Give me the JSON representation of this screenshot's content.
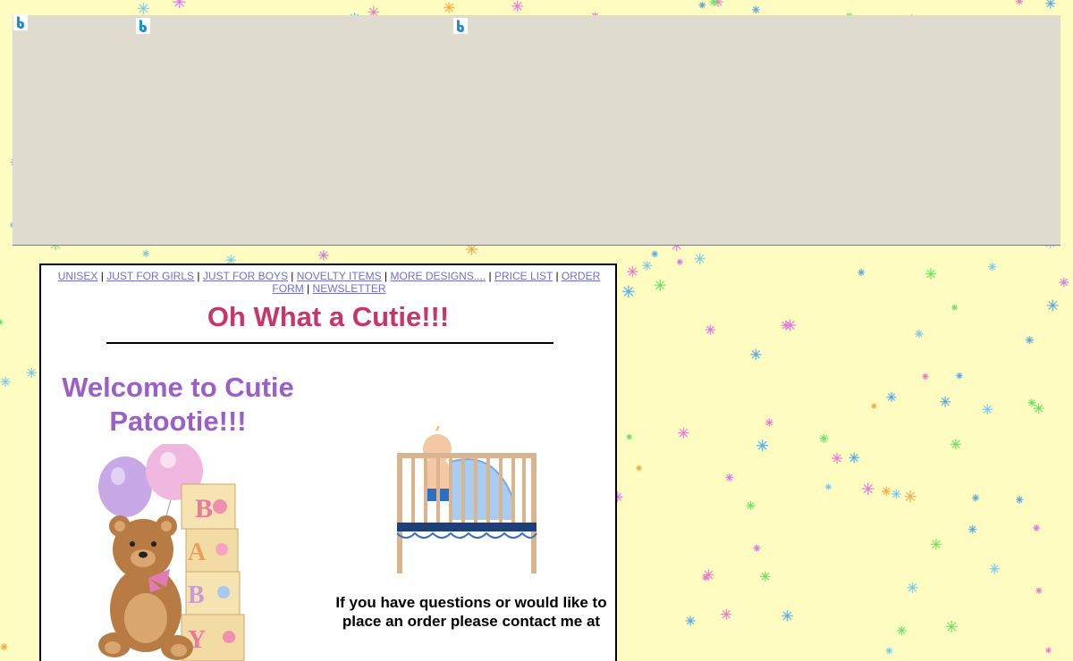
{
  "ad_banner": {
    "icons": [
      "bing-b-icon",
      "bing-b-icon",
      "bing-b-icon"
    ]
  },
  "nav": {
    "links": [
      "UNISEX",
      "JUST FOR GIRLS",
      "JUST FOR BOYS",
      "NOVELTY ITEMS",
      "MORE DESIGNS....",
      "PRICE LIST",
      "ORDER FORM",
      "NEWSLETTER"
    ],
    "separator": " | "
  },
  "page": {
    "title": "Oh What a Cutie!!!",
    "welcome": "Welcome to Cutie Patootie!!!",
    "contact_text": "If you have questions or would like to place an order please contact me at"
  },
  "images": {
    "left": "teddy-bear-with-baby-blocks-and-balloons",
    "right": "baby-in-crib"
  },
  "colors": {
    "background": "#fffcc2",
    "title": "#c8356a",
    "welcome": "#9b5fc8",
    "link": "#6f6fcf"
  }
}
